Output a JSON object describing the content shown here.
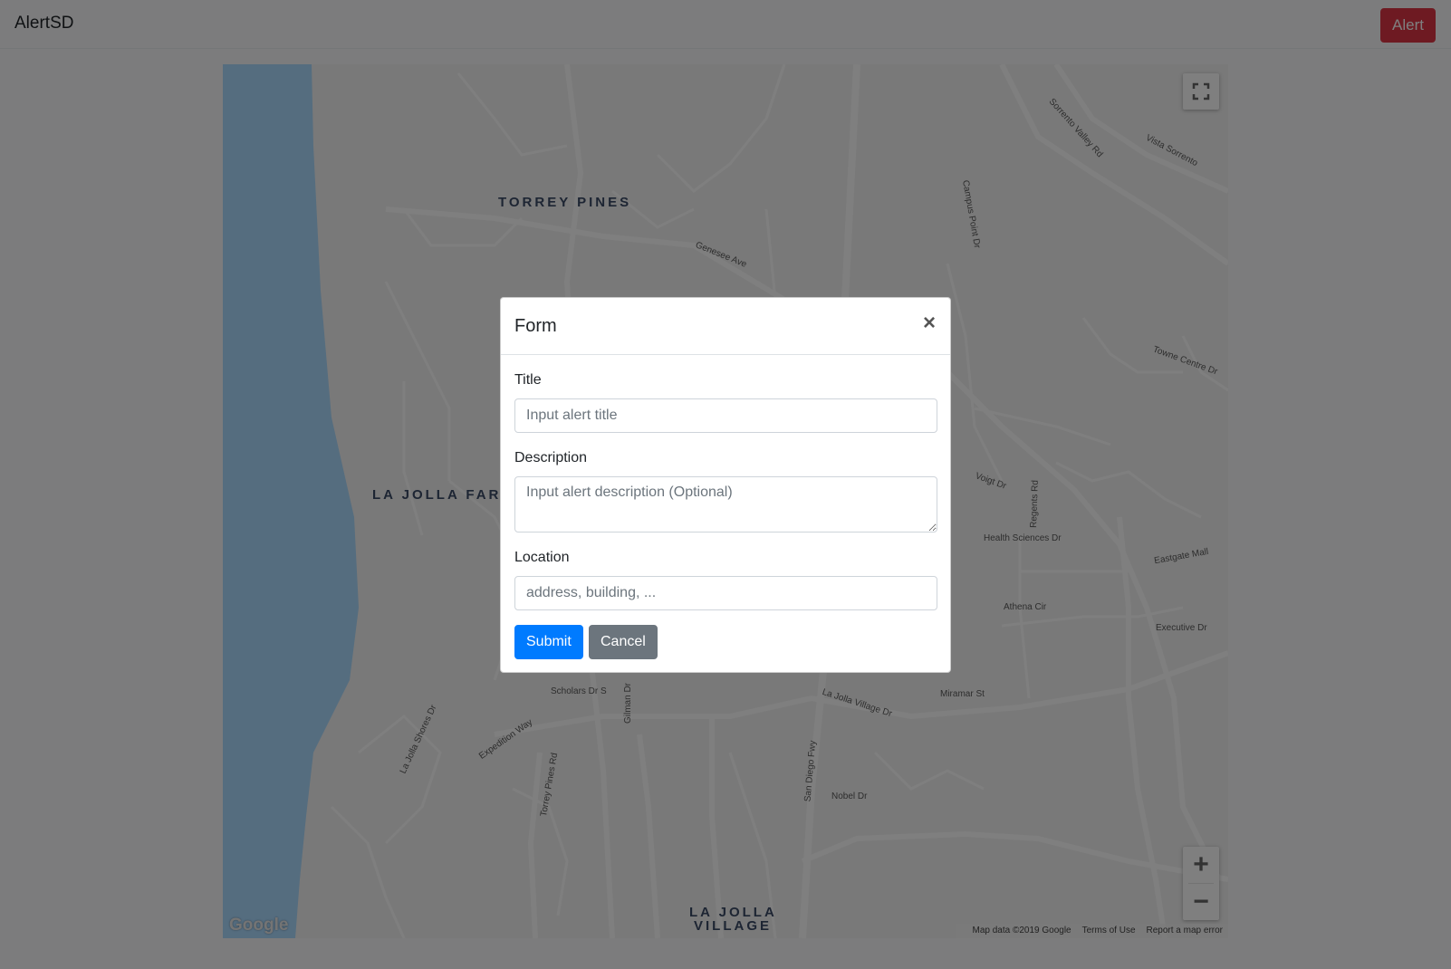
{
  "navbar": {
    "brand": "AlertSD",
    "alert_button": "Alert"
  },
  "map": {
    "area_labels": [
      "TORREY PINES",
      "LA JOLLA FAR",
      "LA JOLLA",
      "VILLAGE"
    ],
    "street_labels": [
      "Genesee Ave",
      "Sorrento Valley Rd",
      "Vista Sorrento",
      "Torrey Pines Rd",
      "La Jolla Village Dr",
      "Nobel Dr",
      "Gilman Dr",
      "San Diego Fwy",
      "Regents Rd",
      "Health Sciences Dr",
      "Eastgate Mall",
      "Executive Dr",
      "Athena Cir",
      "Scholars Dr S",
      "Expedition Way",
      "La Jolla Shores Dr",
      "Voigt Dr",
      "Campus Point Dr",
      "Towne Centre Dr",
      "Miramar St"
    ],
    "attribution": {
      "logo": "Google",
      "map_data": "Map data ©2019 Google",
      "terms": "Terms of Use",
      "report": "Report a map error"
    },
    "zoom_in": "+",
    "zoom_out": "−"
  },
  "modal": {
    "title": "Form",
    "close": "×",
    "fields": {
      "title_label": "Title",
      "title_placeholder": "Input alert title",
      "description_label": "Description",
      "description_placeholder": "Input alert description (Optional)",
      "location_label": "Location",
      "location_placeholder": "address, building, ..."
    },
    "submit": "Submit",
    "cancel": "Cancel"
  },
  "colors": {
    "primary": "#007bff",
    "secondary": "#6c757d",
    "danger": "#dc3545",
    "water": "#aadaff"
  }
}
